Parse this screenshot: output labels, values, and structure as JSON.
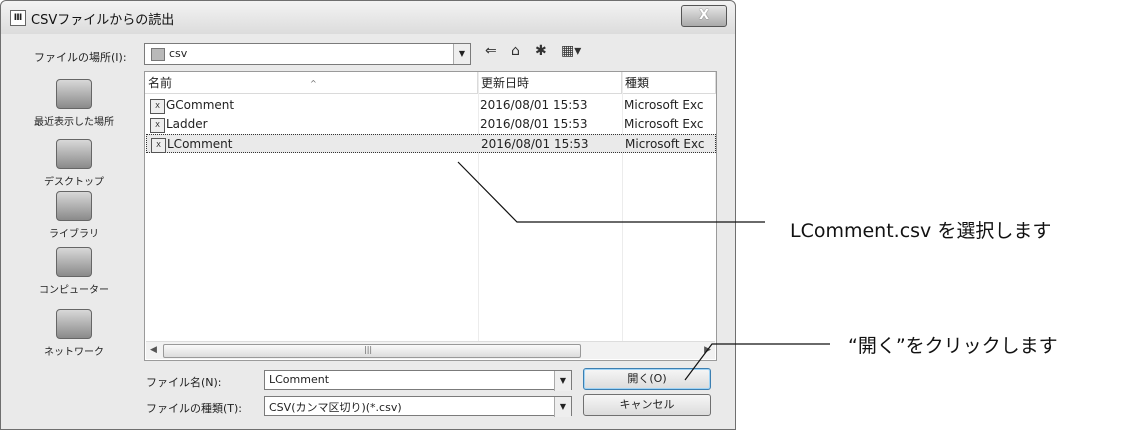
{
  "window": {
    "title": "CSVファイルからの読出",
    "icon_text": "Ⅲ",
    "close_symbol": "X"
  },
  "lookin": {
    "label": "ファイルの場所(I):",
    "value": "csv"
  },
  "places": [
    {
      "label": "最近表示した場所",
      "icon": "recent-places-icon"
    },
    {
      "label": "デスクトップ",
      "icon": "desktop-icon"
    },
    {
      "label": "ライブラリ",
      "icon": "library-icon"
    },
    {
      "label": "コンピューター",
      "icon": "computer-icon"
    },
    {
      "label": "ネットワーク",
      "icon": "network-icon"
    }
  ],
  "columns": {
    "name": "名前",
    "date": "更新日時",
    "type": "種類"
  },
  "files": [
    {
      "name": "GComment",
      "date": "2016/08/01 15:53",
      "type": "Microsoft Exc"
    },
    {
      "name": "Ladder",
      "date": "2016/08/01 15:53",
      "type": "Microsoft Exc"
    },
    {
      "name": "LComment",
      "date": "2016/08/01 15:53",
      "type": "Microsoft Exc"
    }
  ],
  "selected_file_index": 2,
  "filename": {
    "label": "ファイル名(N):",
    "value": "LComment"
  },
  "filetype": {
    "label": "ファイルの種類(T):",
    "value": "CSV(カンマ区切り)(*.csv)"
  },
  "buttons": {
    "open": "開く(O)",
    "cancel": "キャンセル"
  },
  "annotations": {
    "select": "LComment.csv を選択します",
    "click": "“開く”をクリックします"
  }
}
